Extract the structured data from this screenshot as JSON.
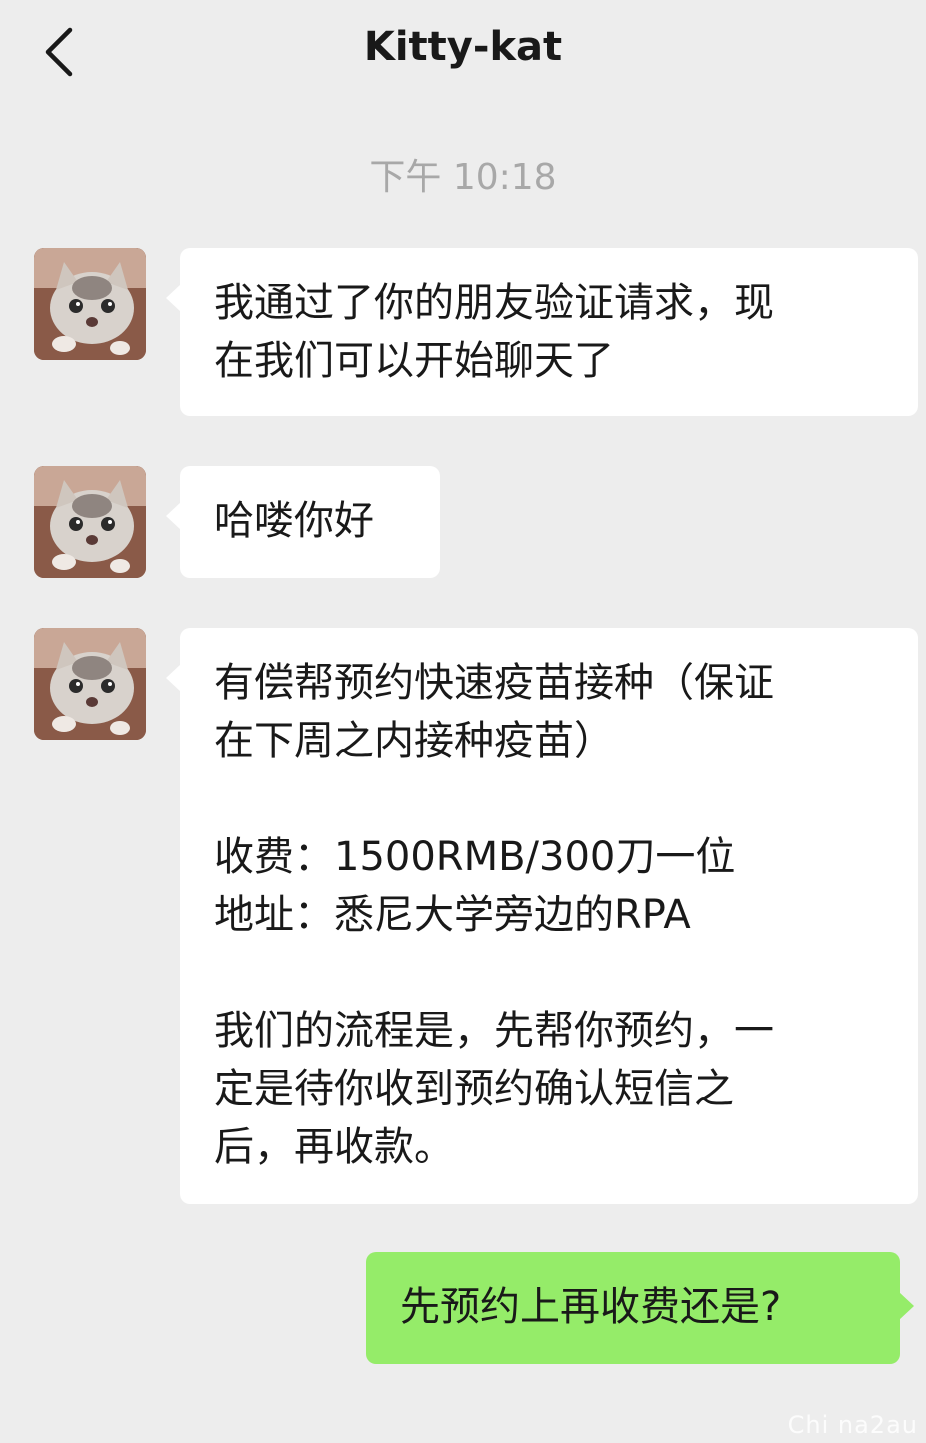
{
  "header": {
    "title": "Kitty-kat",
    "back_icon": "chevron-left-icon"
  },
  "timestamp": "下午 10:18",
  "messages": [
    {
      "sender": "contact",
      "lines": [
        "我通过了你的朋友验证请求，现",
        "在我们可以开始聊天了"
      ]
    },
    {
      "sender": "contact",
      "lines": [
        "哈喽你好"
      ]
    },
    {
      "sender": "contact",
      "lines": [
        "有偿帮预约快速疫苗接种（保证",
        "在下周之内接种疫苗）",
        "",
        "收费：1500RMB/300刀一位",
        "地址：悉尼大学旁边的RPA",
        "",
        "我们的流程是，先帮你预约，一",
        "定是待你收到预约确认短信之",
        "后，再收款。"
      ]
    },
    {
      "sender": "me",
      "lines": [
        "先预约上再收费还是?"
      ]
    }
  ],
  "watermark": "Chi na2au",
  "colors": {
    "background": "#ededed",
    "incoming_bubble": "#ffffff",
    "outgoing_bubble": "#95ec69",
    "timestamp": "#a8a8a8"
  }
}
